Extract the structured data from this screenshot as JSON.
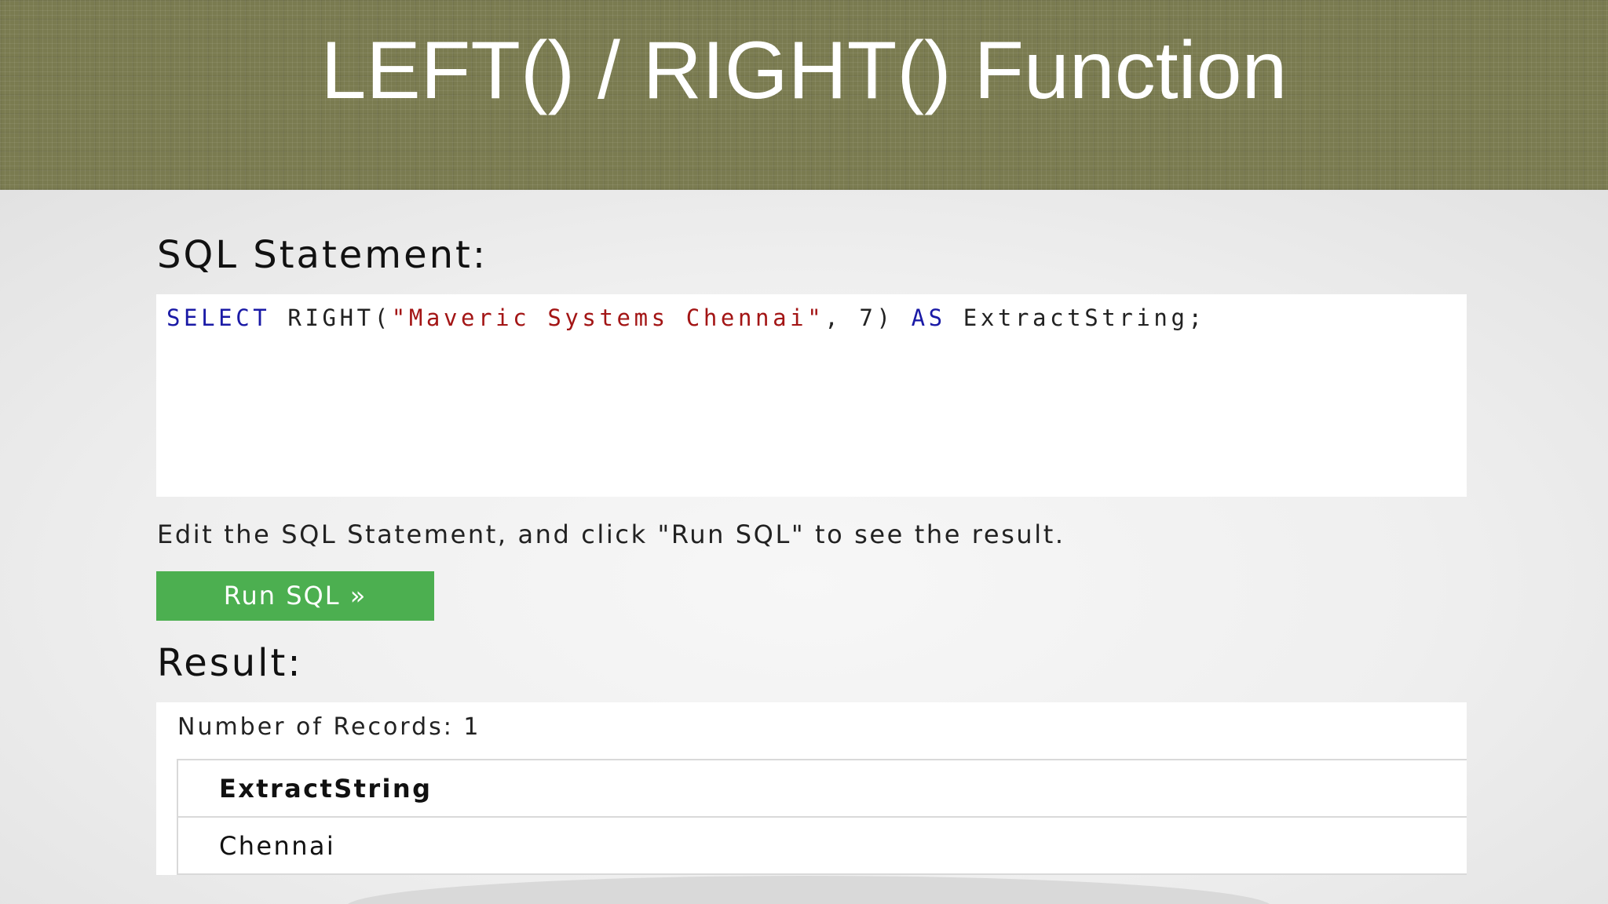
{
  "slide": {
    "title": "LEFT() / RIGHT() Function"
  },
  "sql_section": {
    "heading": "SQL Statement:",
    "code_tokens": {
      "select": "SELECT",
      "right_open": " RIGHT(",
      "string_literal": "\"Maveric Systems Chennai\"",
      "args_rest": ", 7) ",
      "as": "AS",
      "alias_end": " ExtractString;"
    },
    "hint": "Edit the SQL Statement, and click \"Run SQL\" to see the result.",
    "run_button_label": "Run SQL »"
  },
  "result_section": {
    "heading": "Result:",
    "records_text": "Number of Records: 1",
    "columns": [
      "ExtractString"
    ],
    "rows": [
      [
        "Chennai"
      ]
    ]
  },
  "colors": {
    "title_band": "#7a7b50",
    "keyword": "#1a1aa6",
    "string": "#a31515",
    "button": "#4caf50"
  }
}
